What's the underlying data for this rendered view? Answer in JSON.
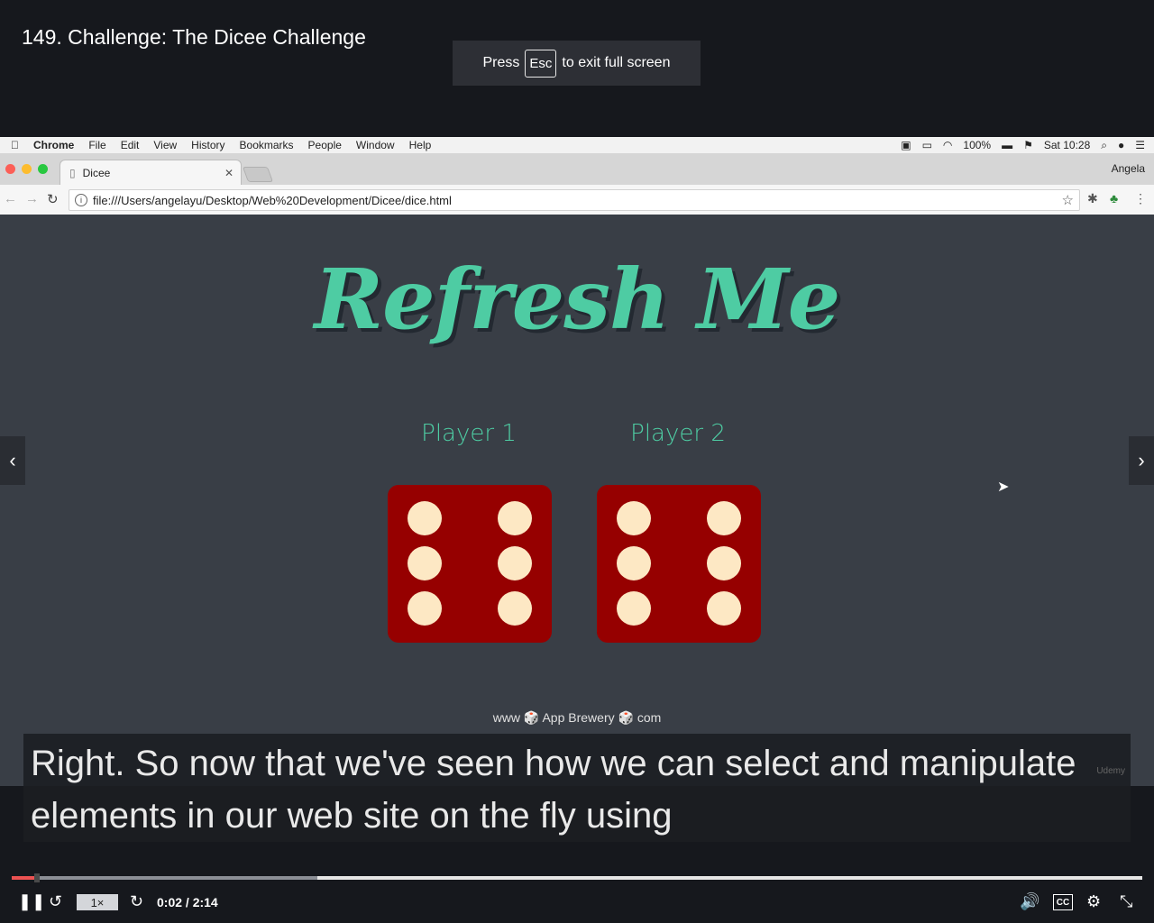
{
  "header": {
    "title": "149. Challenge: The Dicee Challenge"
  },
  "fullscreen_toast": {
    "press": "Press",
    "key": "Esc",
    "rest": "to exit full screen"
  },
  "mac_menu": {
    "app": "Chrome",
    "items": [
      "File",
      "Edit",
      "View",
      "History",
      "Bookmarks",
      "People",
      "Window",
      "Help"
    ],
    "battery": "100%",
    "clock": "Sat 10:28"
  },
  "browser": {
    "tab_title": "Dicee",
    "profile": "Angela",
    "url": "file:///Users/angelayu/Desktop/Web%20Development/Dicee/dice.html"
  },
  "page": {
    "title": "Refresh Me",
    "player1": "Player 1",
    "player2": "Player 2",
    "dice": [
      6,
      6
    ],
    "footer": "www 🎲 App Brewery 🎲 com"
  },
  "caption": "Right. So now that we've seen how we can select and manipulate elements in our web site on the fly using",
  "watermark": "Udemy",
  "controls": {
    "speed": "1×",
    "time": "0:02 / 2:14",
    "progress_played": 0.02,
    "progress_buffered": 0.27,
    "cc": "CC"
  },
  "colors": {
    "accent": "#4ecca3",
    "die": "#960000",
    "pip": "#fde8c4",
    "progress": "#ec5252"
  }
}
